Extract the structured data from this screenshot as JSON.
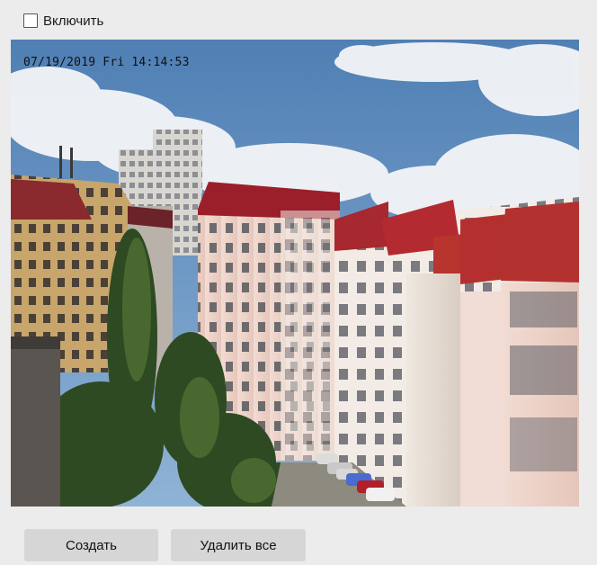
{
  "enable": {
    "label": "Включить",
    "checked": false
  },
  "video": {
    "osd_timestamp": "07/19/2019 Fri 14:14:53"
  },
  "actions": {
    "create_label": "Создать",
    "delete_all_label": "Удалить все"
  }
}
